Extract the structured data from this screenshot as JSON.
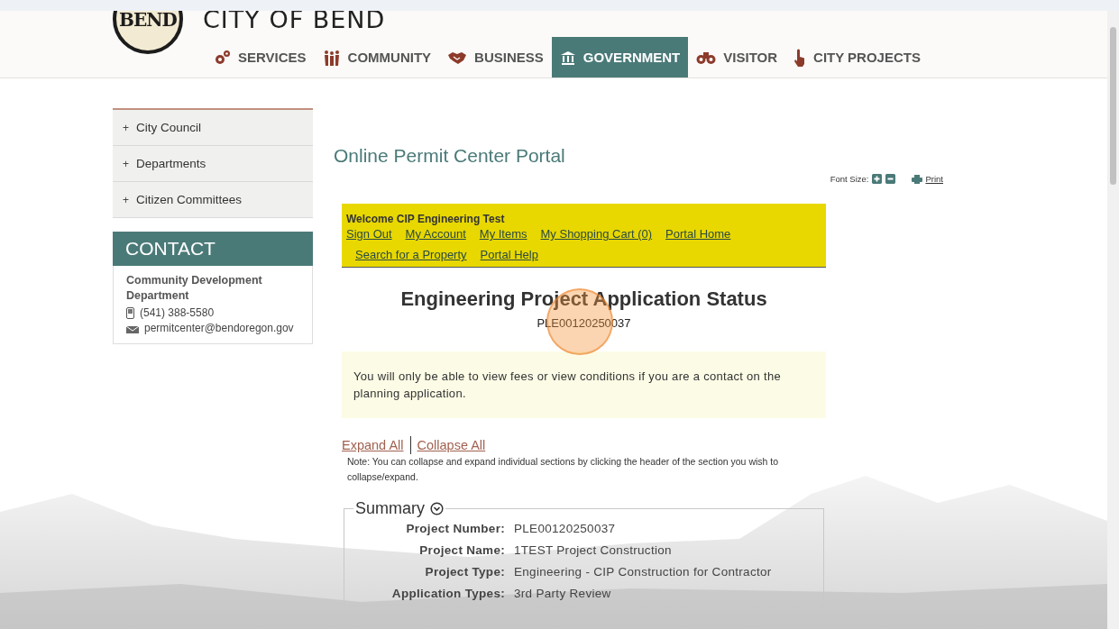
{
  "header": {
    "logo_text": "BEND",
    "title": "CITY OF BEND"
  },
  "nav": [
    {
      "label": "SERVICES",
      "selected": false
    },
    {
      "label": "COMMUNITY",
      "selected": false
    },
    {
      "label": "BUSINESS",
      "selected": false
    },
    {
      "label": "GOVERNMENT",
      "selected": true
    },
    {
      "label": "VISITOR",
      "selected": false
    },
    {
      "label": "CITY PROJECTS",
      "selected": false
    }
  ],
  "sidebar": {
    "items": [
      {
        "marker": "+",
        "label": "City Council"
      },
      {
        "marker": "+",
        "label": "Departments"
      },
      {
        "marker": "+",
        "label": "Citizen Committees"
      }
    ],
    "contact": {
      "heading": "CONTACT",
      "name": "Community Development Department",
      "phone": "(541) 388-5580",
      "email": "permitcenter@bendoregon.gov"
    }
  },
  "page_title": "Online Permit Center Portal",
  "font_size": {
    "label": "Font Size:",
    "print": "Print"
  },
  "welcome": {
    "text": "Welcome CIP Engineering Test",
    "links": [
      "Sign Out",
      "My Account",
      "My Items",
      "My Shopping Cart (0)",
      "Portal Home"
    ],
    "links_row_2": [
      "Search for a Property",
      "Portal Help"
    ]
  },
  "status": {
    "heading": "Engineering Project Application Status",
    "number": "PLE00120250037"
  },
  "notice": "You will only be able to view fees or view conditions if you are a contact on the planning application.",
  "expand_all": "Expand All",
  "collapse_all": "Collapse All",
  "note": "Note: You can collapse and expand individual sections by clicking the header of the section you wish to collapse/expand.",
  "summary": {
    "title": "Summary",
    "expanded": true,
    "fields": [
      {
        "label": "Project Number:",
        "value": "PLE00120250037"
      },
      {
        "label": "Project Name:",
        "value": "1TEST Project Construction"
      },
      {
        "label": "Project Type:",
        "value": "Engineering - CIP Construction for Contractor"
      },
      {
        "label": "Application Types:",
        "value": "3rd Party Review"
      }
    ]
  }
}
